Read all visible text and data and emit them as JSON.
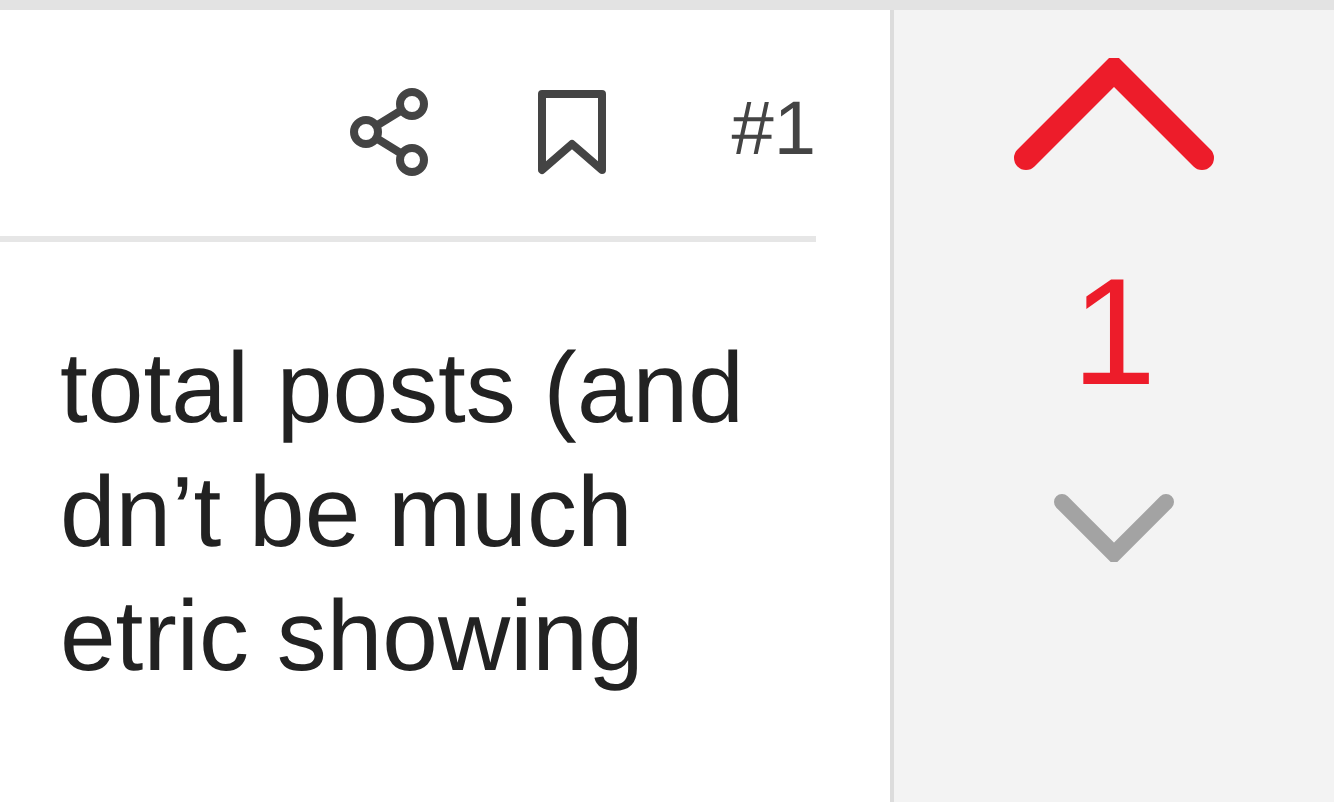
{
  "post": {
    "actions": [
      {
        "kind": "share"
      },
      {
        "kind": "bookmark"
      }
    ],
    "number": "#1",
    "body_lines": [
      "total posts (and",
      "dn’t be much",
      "etric showing"
    ]
  },
  "vote": {
    "score": "1",
    "upvoted": true,
    "downvoted": false
  }
}
